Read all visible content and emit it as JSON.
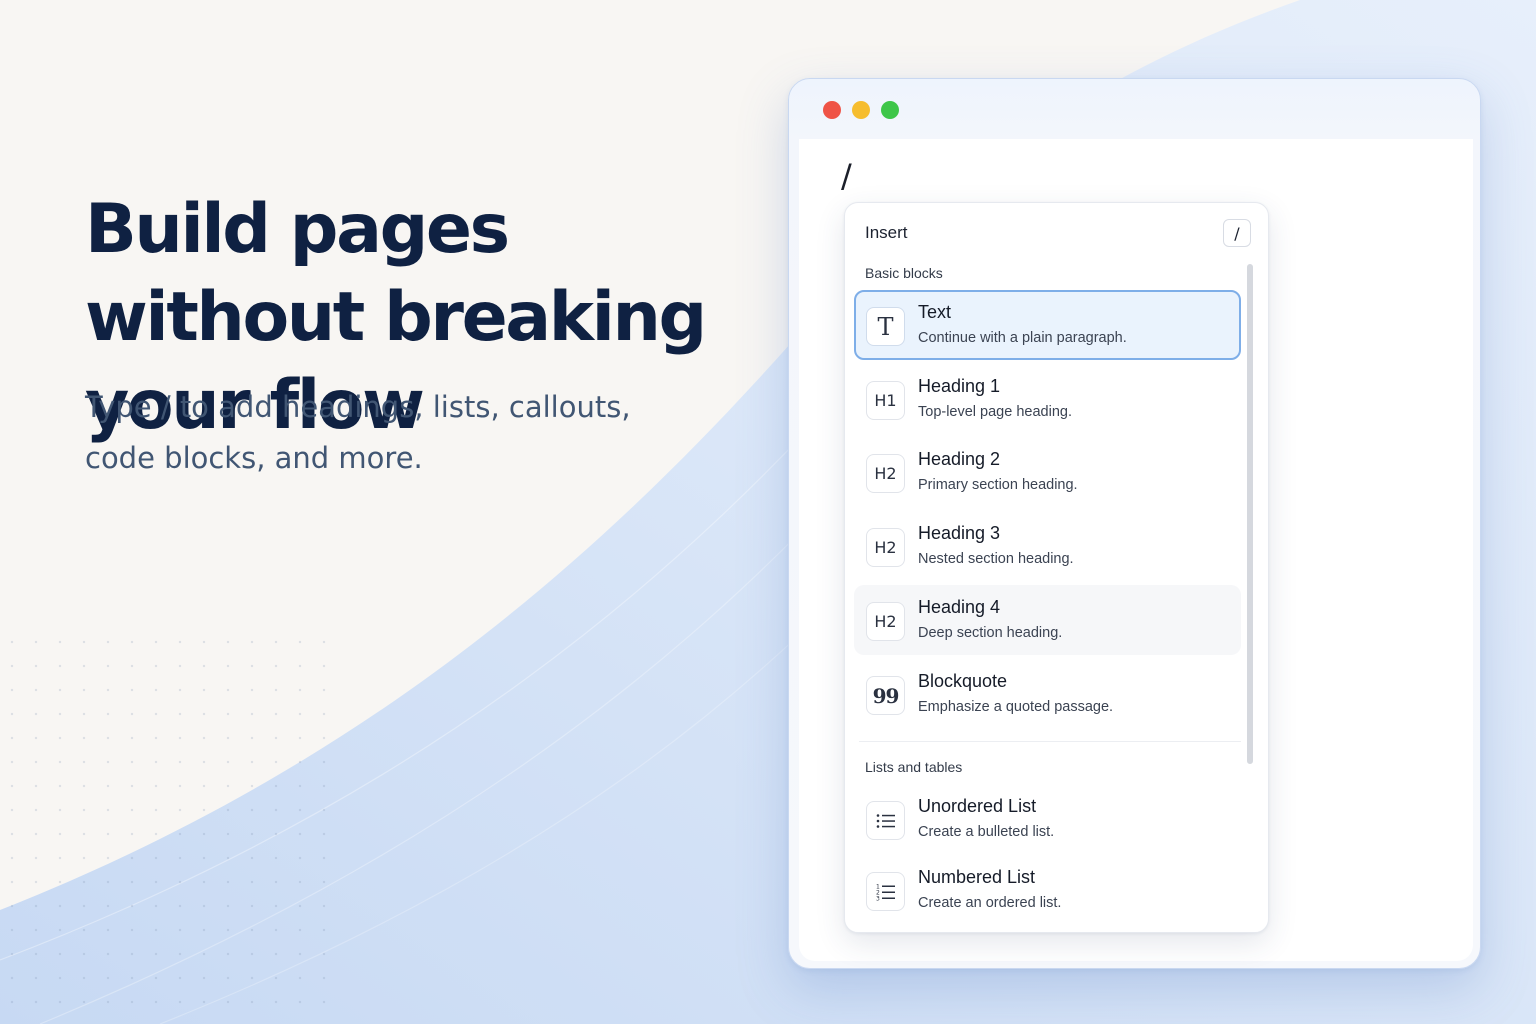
{
  "hero": {
    "headline": "Build pages without breaking your flow",
    "subhead": "Type / to add headings, lists, callouts, code blocks, and more."
  },
  "window": {
    "typed_text": "/",
    "menu": {
      "title": "Insert",
      "shortcut": "/",
      "sections": [
        {
          "label": "Basic blocks",
          "items": [
            {
              "icon": "text-icon",
              "glyph": "T",
              "title": "Text",
              "description": "Continue with a plain paragraph.",
              "state": "selected"
            },
            {
              "icon": "heading-1-icon",
              "glyph": "H1",
              "title": "Heading 1",
              "description": "Top-level page heading.",
              "state": "default"
            },
            {
              "icon": "heading-2-icon",
              "glyph": "H2",
              "title": "Heading 2",
              "description": "Primary section heading.",
              "state": "default"
            },
            {
              "icon": "heading-3-icon",
              "glyph": "H2",
              "title": "Heading 3",
              "description": "Nested section heading.",
              "state": "default"
            },
            {
              "icon": "heading-4-icon",
              "glyph": "H2",
              "title": "Heading 4",
              "description": "Deep section heading.",
              "state": "hovered"
            },
            {
              "icon": "blockquote-icon",
              "glyph": "99",
              "title": "Blockquote",
              "description": "Emphasize a quoted passage.",
              "state": "default"
            }
          ]
        },
        {
          "label": "Lists and tables",
          "items": [
            {
              "icon": "bulleted-list-icon",
              "title": "Unordered List",
              "description": "Create a bulleted list.",
              "state": "default"
            },
            {
              "icon": "numbered-list-icon",
              "title": "Numbered List",
              "description": "Create an ordered list.",
              "state": "default"
            }
          ]
        }
      ]
    }
  },
  "colors": {
    "headline": "#0f2142",
    "subhead": "#415673",
    "selected_bg": "#eaf3fd",
    "selected_border": "#7eaee8",
    "traffic_red": "#ef5346",
    "traffic_yellow": "#f6bd2e",
    "traffic_green": "#3ec649"
  }
}
